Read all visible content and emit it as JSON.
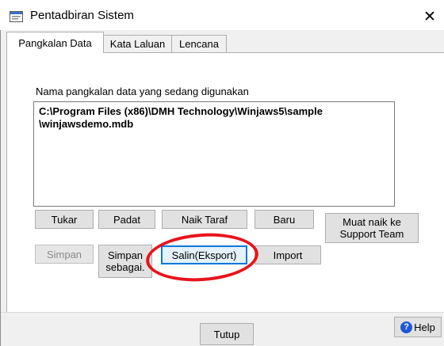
{
  "window": {
    "title": "Pentadbiran Sistem",
    "close_glyph": "✕",
    "icon": "app-window-icon"
  },
  "tabs": [
    {
      "label": "Pangkalan Data",
      "active": true
    },
    {
      "label": "Kata Laluan",
      "active": false
    },
    {
      "label": "Lencana",
      "active": false
    }
  ],
  "database": {
    "label": "Nama pangkalan data yang sedang digunakan",
    "path_line1": "C:\\Program Files (x86)\\DMH Technology\\Winjaws5\\sample",
    "path_line2": "\\winjawsdemo.mdb"
  },
  "buttons": {
    "tukar": "Tukar",
    "padat": "Padat",
    "naik_taraf": "Naik Taraf",
    "baru": "Baru",
    "muat_naik_line1": "Muat naik ke",
    "muat_naik_line2": "Support Team",
    "simpan": "Simpan",
    "simpan_sebagai_line1": "Simpan",
    "simpan_sebagai_line2": "sebagai.",
    "salin_eksport": "Salin(Eksport)",
    "import": "Import",
    "tutup": "Tutup",
    "help": "Help"
  },
  "annotation": {
    "color": "#e8141b",
    "shape": "ellipse-highlight"
  }
}
